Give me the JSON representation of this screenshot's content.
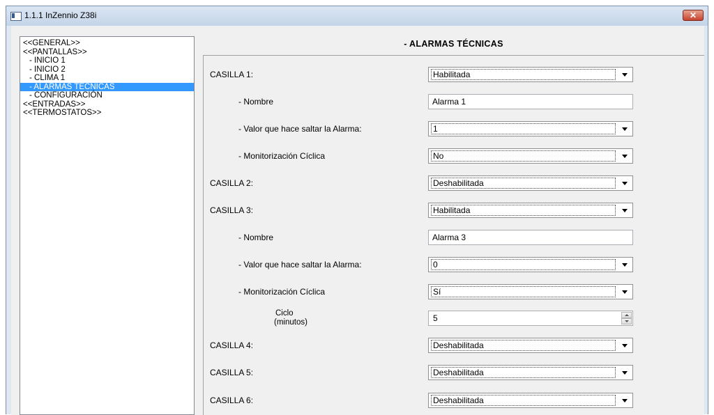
{
  "window": {
    "title": "1.1.1 InZennio Z38i",
    "close_label": "✕"
  },
  "tree": {
    "items": [
      {
        "label": "<<GENERAL>>"
      },
      {
        "label": "<<PANTALLAS>>"
      },
      {
        "label": "- INICIO 1"
      },
      {
        "label": "- INICIO 2"
      },
      {
        "label": "- CLIMA 1"
      },
      {
        "label": "- ALARMAS TÉCNICAS",
        "selected": true
      },
      {
        "label": "- CONFIGURACIÓN"
      },
      {
        "label": "<<ENTRADAS>>"
      },
      {
        "label": "<<TERMOSTATOS>>"
      }
    ]
  },
  "section": {
    "title": "- ALARMAS TÉCNICAS"
  },
  "params": {
    "casilla1": {
      "label": "CASILLA 1:",
      "value": "Habilitada"
    },
    "nombre1": {
      "label": "- Nombre",
      "value": "Alarma 1"
    },
    "valor1": {
      "label": "- Valor que hace saltar la Alarma:",
      "value": "1"
    },
    "monit1": {
      "label": "- Monitorización Cíclica",
      "value": "No"
    },
    "casilla2": {
      "label": "CASILLA 2:",
      "value": "Deshabilitada"
    },
    "casilla3": {
      "label": "CASILLA 3:",
      "value": "Habilitada"
    },
    "nombre3": {
      "label": "- Nombre",
      "value": "Alarma 3"
    },
    "valor3": {
      "label": "- Valor que hace saltar la Alarma:",
      "value": "0"
    },
    "monit3": {
      "label": "- Monitorización Cíclica",
      "value": "Sí"
    },
    "ciclo3": {
      "label_line1": "Ciclo",
      "label_line2": "(minutos)",
      "value": "5"
    },
    "casilla4": {
      "label": "CASILLA 4:",
      "value": "Deshabilitada"
    },
    "casilla5": {
      "label": "CASILLA 5:",
      "value": "Deshabilitada"
    },
    "casilla6": {
      "label": "CASILLA 6:",
      "value": "Deshabilitada"
    }
  }
}
